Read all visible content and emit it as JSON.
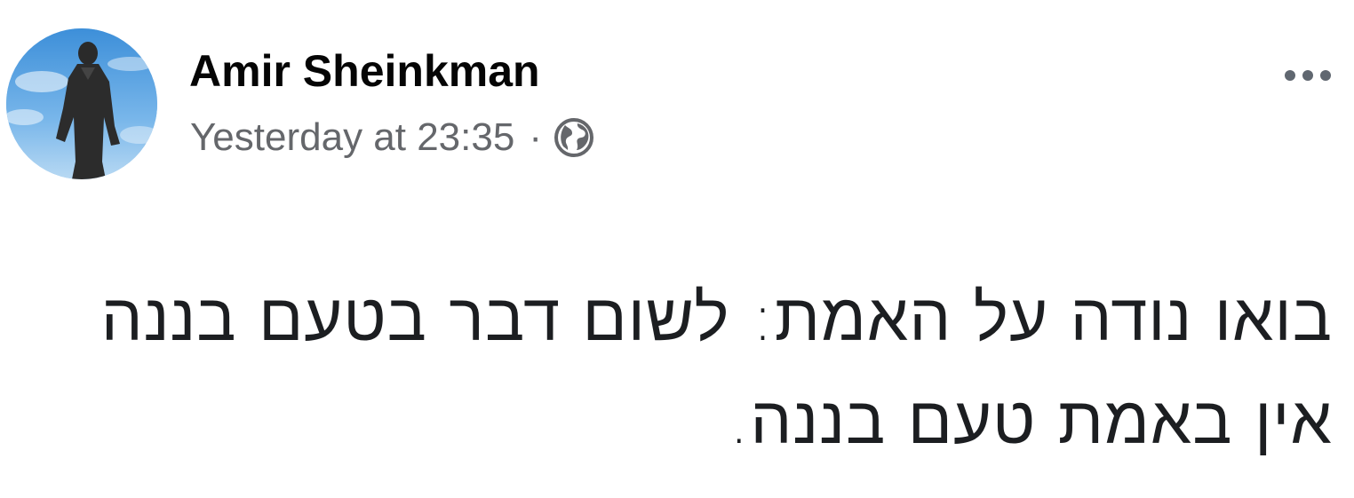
{
  "post": {
    "author": {
      "name": "Amir Sheinkman",
      "avatar_icon": "profile-photo-statue"
    },
    "meta": {
      "timestamp": "Yesterday at 23:35",
      "separator": "·",
      "audience_icon": "globe-icon"
    },
    "menu_icon": "more-options-icon",
    "body_text": "בואו נודה על האמת: לשום דבר בטעם בננה אין באמת טעם בננה."
  },
  "colors": {
    "name": "#050505",
    "meta": "#65676b",
    "body": "#1c1e21",
    "menu_dots": "#606770"
  }
}
